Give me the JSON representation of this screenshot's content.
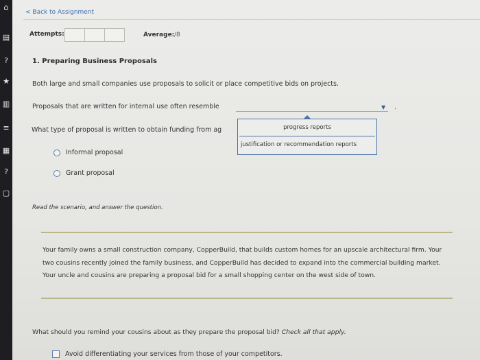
{
  "sidebar": {
    "icons": [
      {
        "name": "home-icon",
        "glyph": "⌂"
      },
      {
        "name": "assignment-icon",
        "glyph": "▤"
      },
      {
        "name": "help-circle-icon",
        "glyph": "?"
      },
      {
        "name": "star-icon",
        "glyph": "★"
      },
      {
        "name": "book-icon",
        "glyph": "▥"
      },
      {
        "name": "layers-icon",
        "glyph": "≡"
      },
      {
        "name": "calculator-icon",
        "glyph": "▦"
      },
      {
        "name": "question-icon",
        "glyph": "?"
      },
      {
        "name": "chat-icon",
        "glyph": "▢"
      }
    ]
  },
  "header": {
    "back_link": "< Back to Assignment"
  },
  "status": {
    "attempts_label": "Attempts:",
    "average_label": "Average:",
    "average_value": "/8"
  },
  "question1": {
    "title": "1. Preparing Business Proposals",
    "description": "Both large and small companies use proposals to solicit or place competitive bids on projects.",
    "blank_prompt": "Proposals that are written for internal use often resemble",
    "blank_end": ".",
    "funding_prompt": "What type of proposal is written to obtain funding from ag",
    "dropdown_options": [
      "progress reports",
      "justification or recommendation reports"
    ],
    "radio_options": [
      "Informal proposal",
      "Grant proposal"
    ]
  },
  "scenario": {
    "intro": "Read the scenario, and answer the question.",
    "text": "Your family owns a small construction company, CopperBuild, that builds custom homes for an upscale architectural firm. Your two cousins recently joined the family business, and CopperBuild has decided to expand into the commercial building market. Your uncle and cousins are preparing a proposal bid for a small shopping center on the west side of town."
  },
  "question2": {
    "prompt": "What should you remind your cousins about as they prepare the proposal bid?",
    "instruction": "Check all that apply.",
    "options": [
      "Avoid differentiating your services from those of your competitors."
    ]
  },
  "colors": {
    "link": "#3b6fb1",
    "dropdown_border": "#4a73a8",
    "divider_olive": "#b9b78a",
    "sidebar": "#1e1e22"
  }
}
